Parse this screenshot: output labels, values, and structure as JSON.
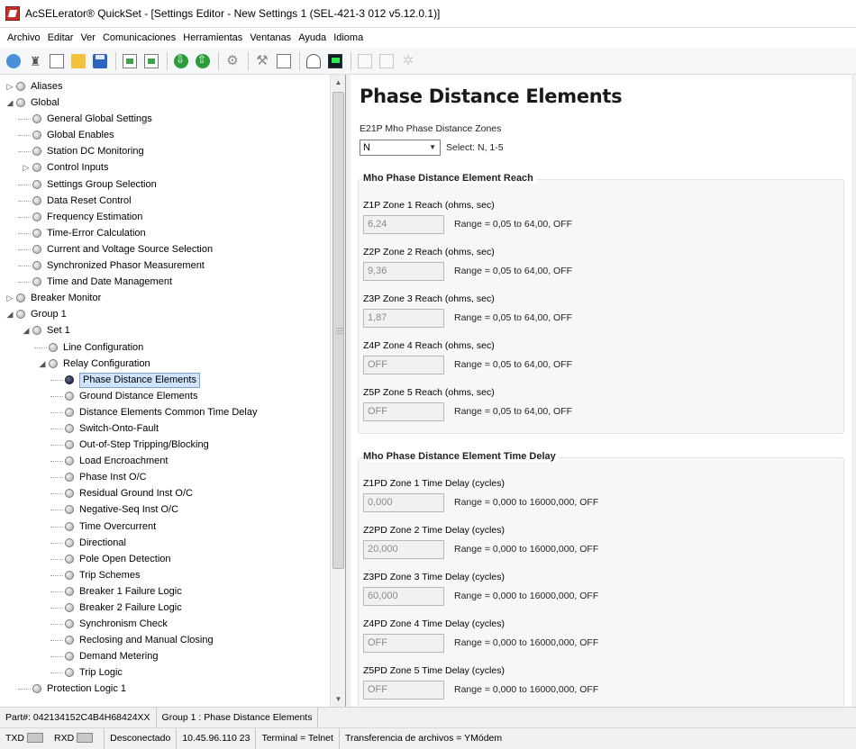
{
  "window": {
    "title": "AcSELerator® QuickSet - [Settings Editor - New Settings 1 (SEL-421-3 012 v5.12.0.1)]"
  },
  "menu": [
    "Archivo",
    "Editar",
    "Ver",
    "Comunicaciones",
    "Herramientas",
    "Ventanas",
    "Ayuda",
    "Idioma"
  ],
  "toolbar_icons": [
    "globe-icon",
    "tower-icon",
    "new-page-icon",
    "open-folder-icon",
    "save-icon",
    "page-send-icon",
    "page-receive-icon",
    "download-icon",
    "upload-icon",
    "network-icon",
    "setup-icon",
    "transfer-icon",
    "meter-icon",
    "terminal-icon",
    "doc-disabled-icon",
    "doc2-disabled-icon",
    "gear-disabled-icon"
  ],
  "tree": [
    {
      "label": "Aliases",
      "level": 0,
      "exp": "▷"
    },
    {
      "label": "Global",
      "level": 0,
      "exp": "◢"
    },
    {
      "label": "General Global Settings",
      "level": 1
    },
    {
      "label": "Global Enables",
      "level": 1
    },
    {
      "label": "Station DC Monitoring",
      "level": 1
    },
    {
      "label": "Control Inputs",
      "level": 1,
      "exp": "▷"
    },
    {
      "label": "Settings Group Selection",
      "level": 1
    },
    {
      "label": "Data Reset Control",
      "level": 1
    },
    {
      "label": "Frequency Estimation",
      "level": 1
    },
    {
      "label": "Time-Error Calculation",
      "level": 1
    },
    {
      "label": "Current and Voltage Source Selection",
      "level": 1
    },
    {
      "label": "Synchronized Phasor Measurement",
      "level": 1
    },
    {
      "label": "Time and Date Management",
      "level": 1
    },
    {
      "label": "Breaker Monitor",
      "level": 0,
      "exp": "▷"
    },
    {
      "label": "Group 1",
      "level": 0,
      "exp": "◢"
    },
    {
      "label": "Set 1",
      "level": 1,
      "exp": "◢"
    },
    {
      "label": "Line Configuration",
      "level": 2
    },
    {
      "label": "Relay Configuration",
      "level": 2,
      "exp": "◢"
    },
    {
      "label": "Phase Distance Elements",
      "level": 3,
      "selected": true
    },
    {
      "label": "Ground Distance Elements",
      "level": 3
    },
    {
      "label": "Distance Elements Common Time Delay",
      "level": 3
    },
    {
      "label": "Switch-Onto-Fault",
      "level": 3
    },
    {
      "label": "Out-of-Step Tripping/Blocking",
      "level": 3
    },
    {
      "label": "Load Encroachment",
      "level": 3
    },
    {
      "label": "Phase Inst O/C",
      "level": 3
    },
    {
      "label": "Residual Ground Inst O/C",
      "level": 3
    },
    {
      "label": "Negative-Seq Inst O/C",
      "level": 3
    },
    {
      "label": "Time Overcurrent",
      "level": 3
    },
    {
      "label": "Directional",
      "level": 3
    },
    {
      "label": "Pole Open Detection",
      "level": 3
    },
    {
      "label": "Trip Schemes",
      "level": 3
    },
    {
      "label": "Breaker 1 Failure Logic",
      "level": 3
    },
    {
      "label": "Breaker 2 Failure Logic",
      "level": 3
    },
    {
      "label": "Synchronism Check",
      "level": 3
    },
    {
      "label": "Reclosing and Manual Closing",
      "level": 3
    },
    {
      "label": "Demand Metering",
      "level": 3
    },
    {
      "label": "Trip Logic",
      "level": 3
    },
    {
      "label": "Protection Logic 1",
      "level": 1
    }
  ],
  "content": {
    "title": "Phase Distance Elements",
    "e21p_label": "E21P  Mho Phase Distance Zones",
    "e21p_value": "N",
    "e21p_hint": "Select: N, 1-5",
    "reach_group": {
      "title": "Mho Phase Distance Element Reach",
      "fields": [
        {
          "label": "Z1P  Zone 1 Reach (ohms, sec)",
          "value": "6,24",
          "range": "Range = 0,05 to 64,00, OFF"
        },
        {
          "label": "Z2P  Zone 2 Reach (ohms, sec)",
          "value": "9,36",
          "range": "Range = 0,05 to 64,00, OFF"
        },
        {
          "label": "Z3P  Zone 3 Reach (ohms, sec)",
          "value": "1,87",
          "range": "Range = 0,05 to 64,00, OFF"
        },
        {
          "label": "Z4P  Zone 4 Reach (ohms, sec)",
          "value": "OFF",
          "range": "Range = 0,05 to 64,00, OFF"
        },
        {
          "label": "Z5P  Zone 5 Reach (ohms, sec)",
          "value": "OFF",
          "range": "Range = 0,05 to 64,00, OFF"
        }
      ]
    },
    "delay_group": {
      "title": "Mho Phase Distance Element Time Delay",
      "fields": [
        {
          "label": "Z1PD  Zone 1 Time Delay (cycles)",
          "value": "0,000",
          "range": "Range = 0,000 to 16000,000, OFF"
        },
        {
          "label": "Z2PD  Zone 2 Time Delay (cycles)",
          "value": "20,000",
          "range": "Range = 0,000 to 16000,000, OFF"
        },
        {
          "label": "Z3PD  Zone 3 Time Delay (cycles)",
          "value": "60,000",
          "range": "Range = 0,000 to 16000,000, OFF"
        },
        {
          "label": "Z4PD  Zone 4 Time Delay (cycles)",
          "value": "OFF",
          "range": "Range = 0,000 to 16000,000, OFF"
        },
        {
          "label": "Z5PD  Zone 5 Time Delay (cycles)",
          "value": "OFF",
          "range": "Range = 0,000 to 16000,000, OFF"
        }
      ]
    }
  },
  "status1": {
    "part": "Part#: 042134152C4B4H68424XX",
    "location": "Group 1 : Phase Distance Elements"
  },
  "status2": {
    "txd": "TXD",
    "rxd": "RXD",
    "connection": "Desconectado",
    "address": "10.45.96.110  23",
    "terminal": "Terminal = Telnet",
    "transfer": "Transferencia de archivos = YMódem"
  }
}
